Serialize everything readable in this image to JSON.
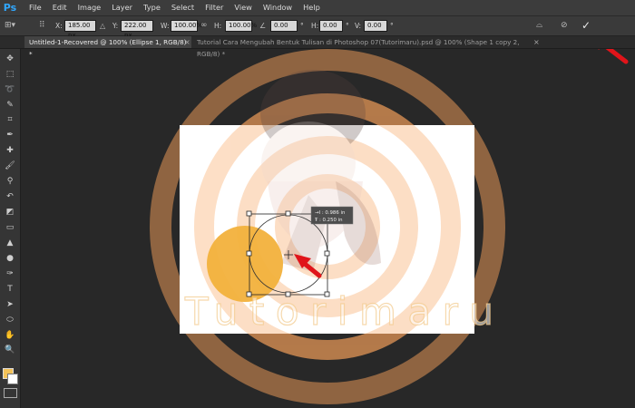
{
  "app": {
    "logo": "Ps"
  },
  "menu": [
    "File",
    "Edit",
    "Image",
    "Layer",
    "Type",
    "Select",
    "Filter",
    "View",
    "Window",
    "Help"
  ],
  "options": {
    "x_label": "X:",
    "x_value": "185.00 px",
    "y_label": "Y:",
    "y_value": "222.00 px",
    "w_label": "W:",
    "w_value": "100.00%",
    "h_label": "H:",
    "h_value": "100.00%",
    "angle_value": "0.00",
    "deg1": "°",
    "hskew_label": "H:",
    "hskew_value": "0.00",
    "deg2": "°",
    "vskew_label": "V:",
    "vskew_value": "0.00",
    "deg3": "°"
  },
  "tabs": [
    {
      "label": "Untitled-1-Recovered @ 100% (Ellipse 1, RGB/8) *",
      "close": "×"
    },
    {
      "label": "Tutorial Cara Mengubah Bentuk Tulisan di Photoshop 07(Tutorimaru).psd @ 100% (Shape 1 copy 2, RGB/8) *",
      "close": "×"
    }
  ],
  "tooltip": {
    "line1": "→I :  0.986 in",
    "line2": "Ŧ :  0.250 in"
  },
  "watermark": {
    "text": "Tutorimaru"
  },
  "colors": {
    "foreground": "#f3c35a",
    "background": "#ffffff",
    "ellipse": "#f2b13c",
    "arrow": "#e0141a",
    "watermark": "#f6a15a"
  }
}
